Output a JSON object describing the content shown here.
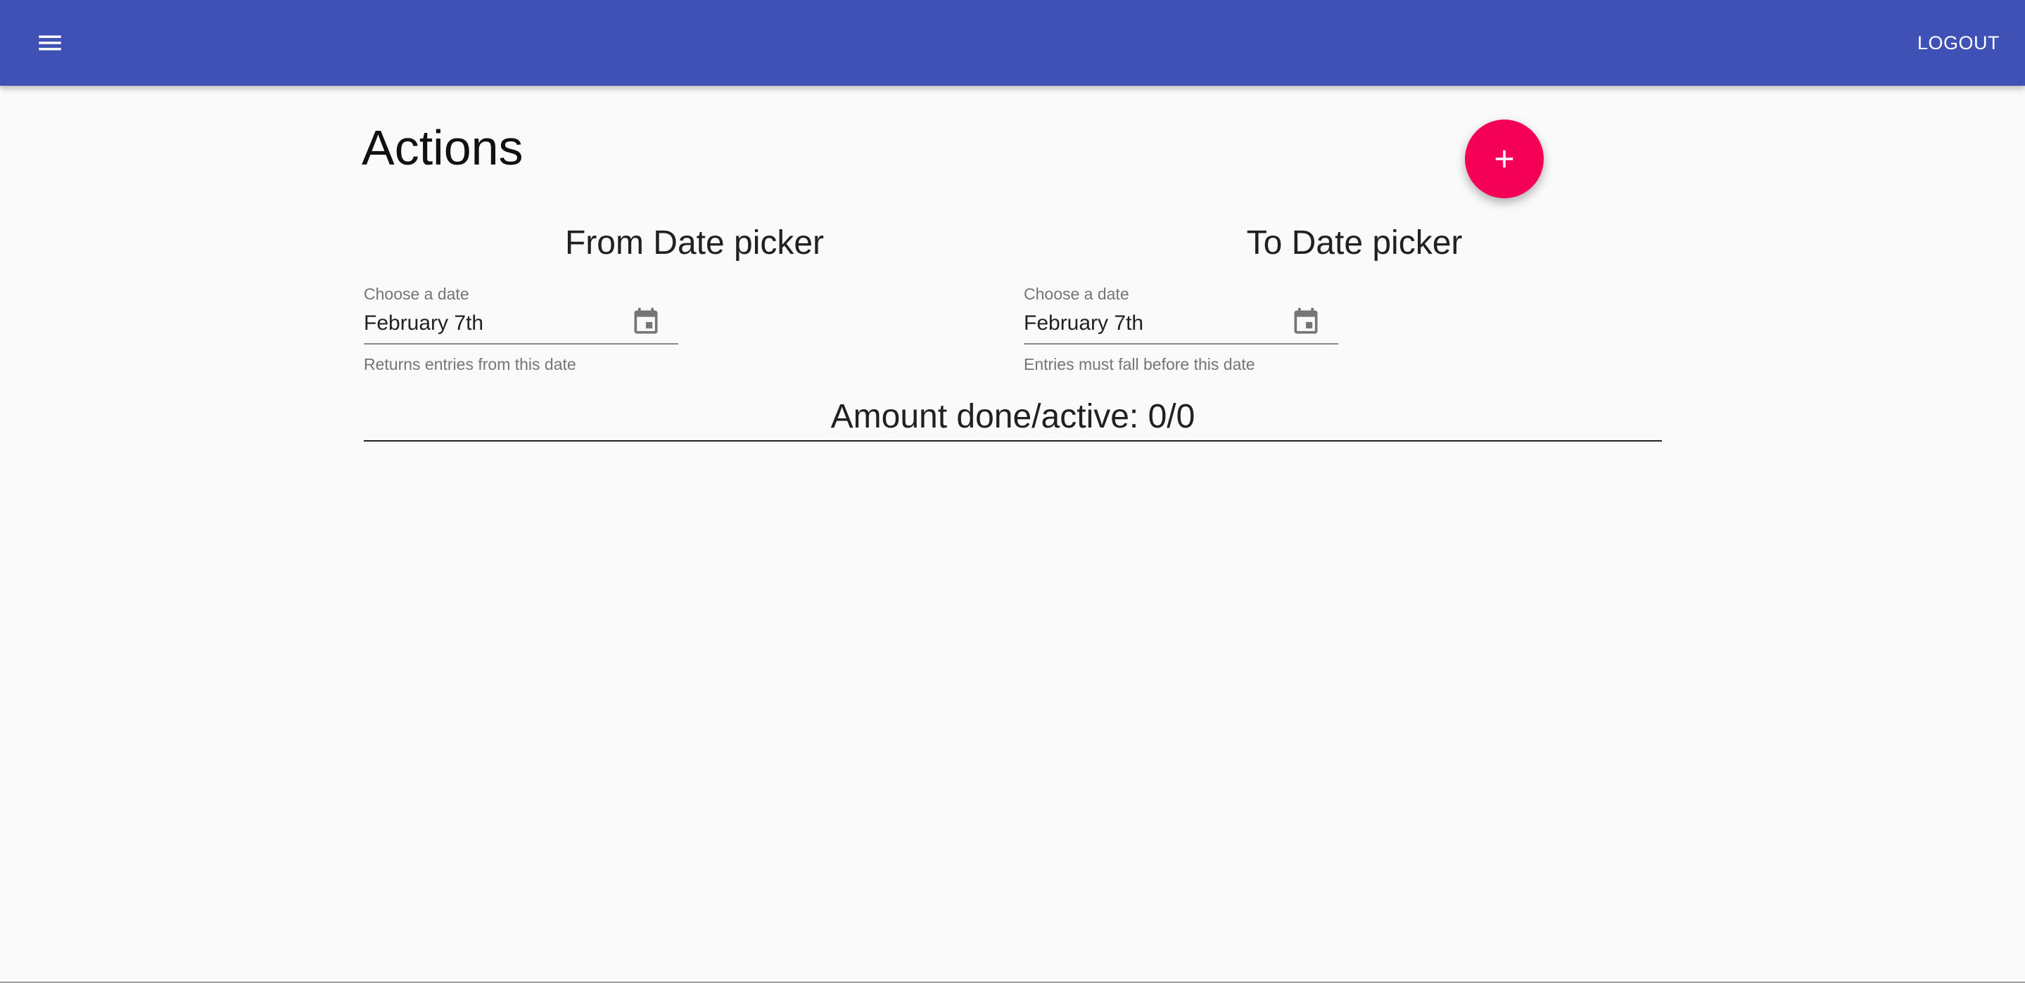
{
  "app_bar": {
    "menu_icon": "menu-icon",
    "logout_label": "LOGOUT",
    "color": "#3f51b5"
  },
  "page": {
    "title": "Actions"
  },
  "fab": {
    "icon": "plus-icon",
    "color": "#f50057"
  },
  "from_picker": {
    "heading": "From Date picker",
    "label": "Choose a date",
    "value": "February 7th",
    "helper": "Returns entries from this date",
    "icon": "calendar-icon"
  },
  "to_picker": {
    "heading": "To Date picker",
    "label": "Choose a date",
    "value": "February 7th",
    "helper": "Entries must fall before this date",
    "icon": "calendar-icon"
  },
  "summary": {
    "text": "Amount done/active: 0/0"
  }
}
